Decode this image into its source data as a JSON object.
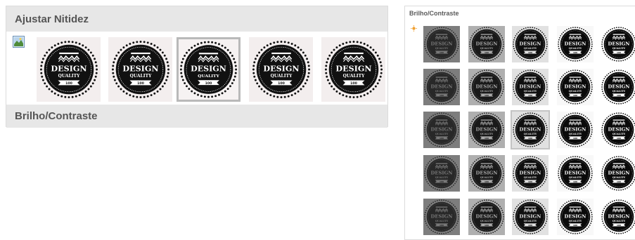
{
  "sharpen_panel": {
    "header": "Ajustar Nitidez",
    "brightness_header": "Brilho/Contraste",
    "icon": "picture-options-icon",
    "presets": [
      {
        "name": "sharpen-preset-1",
        "selected": false
      },
      {
        "name": "sharpen-preset-2",
        "selected": false
      },
      {
        "name": "sharpen-preset-3",
        "selected": true
      },
      {
        "name": "sharpen-preset-4",
        "selected": false
      },
      {
        "name": "sharpen-preset-5",
        "selected": false
      }
    ]
  },
  "brightness_panel": {
    "title": "Brilho/Contraste",
    "icon": "brightness-sun-icon",
    "selected": {
      "row": 2,
      "col": 2
    },
    "rows": 5,
    "cols": 5
  },
  "badge": {
    "line1": "DESIGN",
    "line2": "QUALITY",
    "ribbon": "100"
  },
  "colors": {
    "header_bg": "#e7e7e7",
    "header_text": "#555555",
    "selection_border": "#b9b9b9",
    "badge_dark": "#111111",
    "badge_light": "#ffffff"
  }
}
